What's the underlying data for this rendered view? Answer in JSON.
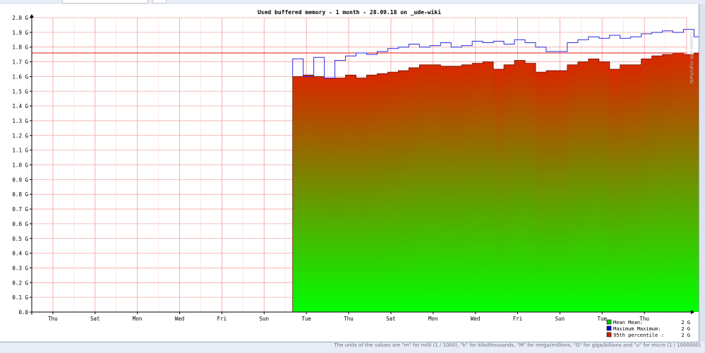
{
  "title": "Used buffered memory - 1 month - 28.09.18 on _ude-wiki",
  "watermark": "Created with Highcharts",
  "footer_note": "The units of the values are \"m\" for milli (1 / 1000), \"k\" for kilo/thousands, \"M\" for mega/millions, \"G\" for giga/billions and \"u\" for micro (1 / 1000000)",
  "legend": [
    {
      "label": "Mean  Mean:",
      "value": "2 G",
      "color": "#00cc00"
    },
    {
      "label": "Maximum  Maximum:",
      "value": "2 G",
      "color": "#0000cc"
    },
    {
      "label": "95th percentile   :",
      "value": "2 G",
      "color": "#cc2200"
    }
  ],
  "colors": {
    "grid": "#f4a8a8",
    "threshold": "#d81818",
    "max_line": "#2b2bd8",
    "bar_top": "#d82800",
    "bar_bottom": "#00ff00",
    "axis_text": "#000000"
  },
  "chart_data": {
    "type": "bar",
    "title": "Used buffered memory - 1 month - 28.09.18 on _ude-wiki",
    "xlabel": "",
    "ylabel": "",
    "y_unit": "G",
    "ylim": [
      0,
      2.0
    ],
    "yticks": [
      0.0,
      0.1,
      0.2,
      0.3,
      0.4,
      0.5,
      0.6,
      0.7,
      0.8,
      0.9,
      1.0,
      1.1,
      1.2,
      1.3,
      1.4,
      1.5,
      1.6,
      1.7,
      1.8,
      1.9,
      2.0
    ],
    "ytick_labels": [
      "0.0",
      "0.1 G",
      "0.2 G",
      "0.3 G",
      "0.4 G",
      "0.5 G",
      "0.6 G",
      "0.7 G",
      "0.8 G",
      "0.9 G",
      "1.0 G",
      "1.1 G",
      "1.2 G",
      "1.3 G",
      "1.4 G",
      "1.5 G",
      "1.6 G",
      "1.7 G",
      "1.8 G",
      "1.9 G",
      "2.0 G"
    ],
    "x_day_labels": [
      "Thu",
      "Sat",
      "Mon",
      "Wed",
      "Fri",
      "Sun",
      "Tue",
      "Thu",
      "Sat",
      "Mon",
      "Wed",
      "Fri",
      "Sun",
      "Tue",
      "Thu"
    ],
    "x_period_days": 31,
    "x_day_label_start": 1,
    "x_day_label_step": 2,
    "data_start_day": 12.35,
    "bar_width_days": 0.5,
    "threshold_95th": 1.76,
    "grid": true,
    "series": [
      {
        "name": "Mean",
        "values": [
          1.6,
          1.61,
          1.6,
          1.59,
          1.59,
          1.61,
          1.59,
          1.61,
          1.62,
          1.63,
          1.64,
          1.66,
          1.68,
          1.68,
          1.67,
          1.67,
          1.68,
          1.69,
          1.7,
          1.65,
          1.68,
          1.71,
          1.69,
          1.63,
          1.64,
          1.64,
          1.68,
          1.7,
          1.72,
          1.7,
          1.65,
          1.68,
          1.68,
          1.72,
          1.74,
          1.75,
          1.76,
          1.75,
          1.76,
          1.76,
          1.7,
          1.69,
          1.71,
          1.7,
          1.74,
          1.72,
          1.74,
          1.76,
          1.8,
          1.72,
          1.7,
          1.73
        ]
      },
      {
        "name": "Maximum",
        "values": [
          1.72,
          1.6,
          1.73,
          1.59,
          1.71,
          1.74,
          1.76,
          1.75,
          1.77,
          1.79,
          1.8,
          1.82,
          1.8,
          1.81,
          1.83,
          1.8,
          1.81,
          1.84,
          1.83,
          1.84,
          1.82,
          1.85,
          1.83,
          1.8,
          1.77,
          1.77,
          1.83,
          1.85,
          1.87,
          1.86,
          1.88,
          1.86,
          1.87,
          1.89,
          1.9,
          1.91,
          1.9,
          1.92,
          1.87,
          1.89,
          1.87,
          1.86,
          1.9,
          1.89,
          1.91,
          1.93,
          1.95,
          1.93,
          1.83,
          1.88,
          1.88
        ]
      }
    ],
    "legend": {
      "entries": [
        "Mean",
        "Maximum",
        "95th percentile"
      ],
      "position": "bottom-right"
    }
  }
}
